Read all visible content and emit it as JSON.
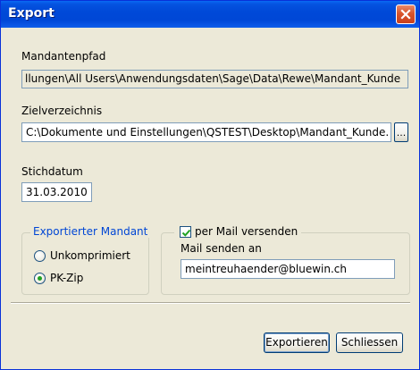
{
  "window": {
    "title": "Export"
  },
  "mandantenpfad": {
    "label": "Mandantenpfad",
    "value": "llungen\\All Users\\Anwendungsdaten\\Sage\\Data\\Rewe\\Mandant_Kunde"
  },
  "zielverzeichnis": {
    "label": "Zielverzeichnis",
    "value": "C:\\Dokumente und Einstellungen\\QSTEST\\Desktop\\Mandant_Kunde.",
    "browse_label": "..."
  },
  "stichdatum": {
    "label": "Stichdatum",
    "value": "31.03.2010"
  },
  "exportierter_mandant": {
    "legend": "Exportierter Mandant",
    "options": [
      {
        "label": "Unkomprimiert",
        "selected": false
      },
      {
        "label": "PK-Zip",
        "selected": true
      }
    ]
  },
  "mail": {
    "checkbox_label": "per Mail versenden",
    "checked": true,
    "address_label": "Mail senden an",
    "address_value": "meintreuhaender@bluewin.ch"
  },
  "buttons": {
    "export_label": "Exportieren",
    "close_label": "Schliessen"
  },
  "colors": {
    "title_bar": "#0047d6",
    "dialog_bg": "#ece9d8",
    "radio_dot": "#21a121",
    "close_button": "#d9552c"
  }
}
